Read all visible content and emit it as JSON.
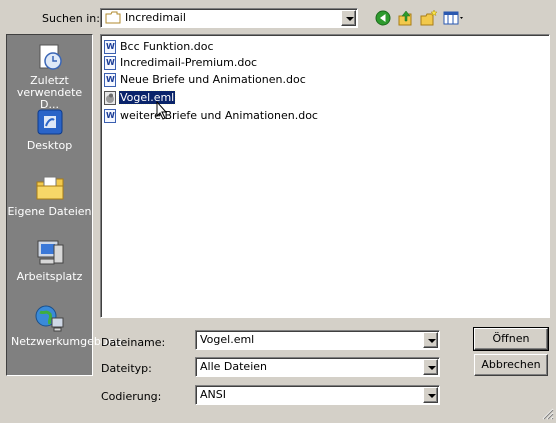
{
  "top": {
    "look_in_label": "Suchen in:",
    "look_in_value": "Incredimail"
  },
  "places": [
    {
      "label": "Zuletzt verwendete D..."
    },
    {
      "label": "Desktop"
    },
    {
      "label": "Eigene Dateien"
    },
    {
      "label": "Arbeitsplatz"
    },
    {
      "label": "Netzwerkumgebung"
    }
  ],
  "files": [
    {
      "name": "Bcc Funktion.doc"
    },
    {
      "name": "Incredimail-Premium.doc"
    },
    {
      "name": "Neue Briefe und Animationen.doc"
    },
    {
      "name": "Vogel.eml"
    },
    {
      "name": "weitere Briefe und Animationen.doc"
    }
  ],
  "form": {
    "filename_label": "Dateiname:",
    "filename_value": "Vogel.eml",
    "filetype_label": "Dateityp:",
    "filetype_value": "Alle Dateien",
    "encoding_label": "Codierung:",
    "encoding_value": "ANSI"
  },
  "buttons": {
    "open": "Öffnen",
    "cancel": "Abbrechen"
  },
  "colors": {
    "dialog_bg": "#d4d0c8",
    "places_bg": "#808080",
    "selection": "#0a246a",
    "back_green": "#2e9a2e",
    "folder_yellow": "#f2c94c"
  },
  "icons": [
    "folder-icon",
    "back-icon",
    "up-folder-icon",
    "new-folder-icon",
    "view-menu-icon",
    "recent-documents-icon",
    "desktop-icon",
    "my-documents-icon",
    "my-computer-icon",
    "network-icon",
    "word-document-icon",
    "email-file-icon"
  ]
}
